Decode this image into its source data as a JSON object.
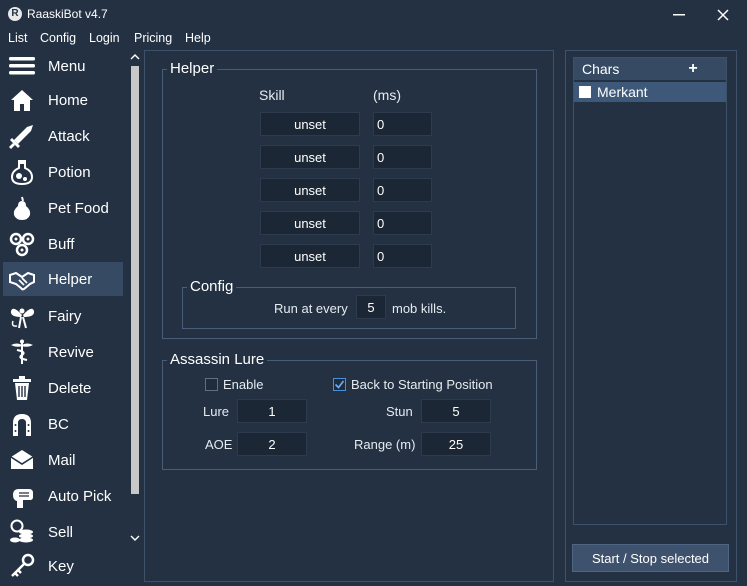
{
  "window": {
    "title": "RaaskiBot v4.7",
    "icon_letter": "R"
  },
  "menu": [
    "List",
    "Config",
    "Login",
    "Pricing",
    "Help"
  ],
  "sidebar": {
    "items": [
      {
        "label": "Menu",
        "icon": "hamburger-icon"
      },
      {
        "label": "Home",
        "icon": "house-icon"
      },
      {
        "label": "Attack",
        "icon": "sword-icon"
      },
      {
        "label": "Potion",
        "icon": "potion-flask-icon"
      },
      {
        "label": "Pet Food",
        "icon": "pear-icon"
      },
      {
        "label": "Buff",
        "icon": "spiral-icon"
      },
      {
        "label": "Helper",
        "icon": "handshake-icon",
        "active": true
      },
      {
        "label": "Fairy",
        "icon": "fairy-icon"
      },
      {
        "label": "Revive",
        "icon": "caduceus-icon"
      },
      {
        "label": "Delete",
        "icon": "trash-icon"
      },
      {
        "label": "BC",
        "icon": "horseshoe-icon"
      },
      {
        "label": "Mail",
        "icon": "envelope-icon"
      },
      {
        "label": "Auto Pick",
        "icon": "hand-grab-icon"
      },
      {
        "label": "Sell",
        "icon": "coins-icon"
      },
      {
        "label": "Key",
        "icon": "key-icon"
      }
    ]
  },
  "helper": {
    "title": "Helper",
    "skill_header": "Skill",
    "ms_header": "(ms)",
    "rows": [
      {
        "skill": "unset",
        "ms": "0"
      },
      {
        "skill": "unset",
        "ms": "0"
      },
      {
        "skill": "unset",
        "ms": "0"
      },
      {
        "skill": "unset",
        "ms": "0"
      },
      {
        "skill": "unset",
        "ms": "0"
      }
    ],
    "config": {
      "title": "Config",
      "prefix": "Run at every",
      "value": "5",
      "suffix": "mob kills."
    }
  },
  "lure": {
    "title": "Assassin Lure",
    "enable_label": "Enable",
    "enable_checked": false,
    "back_label": "Back to Starting Position",
    "back_checked": true,
    "lure_label": "Lure",
    "lure_value": "1",
    "stun_label": "Stun",
    "stun_value": "5",
    "aoe_label": "AOE",
    "aoe_value": "2",
    "range_label": "Range (m)",
    "range_value": "25"
  },
  "chars": {
    "header": "Chars",
    "add_label": "+",
    "items": [
      {
        "name": "Merkant",
        "checked": false
      }
    ]
  },
  "start_stop_label": "Start / Stop selected",
  "colors": {
    "background": "#233142",
    "selected": "#364a63",
    "field": "#1b2735",
    "accent_check": "#4a8fd9"
  }
}
